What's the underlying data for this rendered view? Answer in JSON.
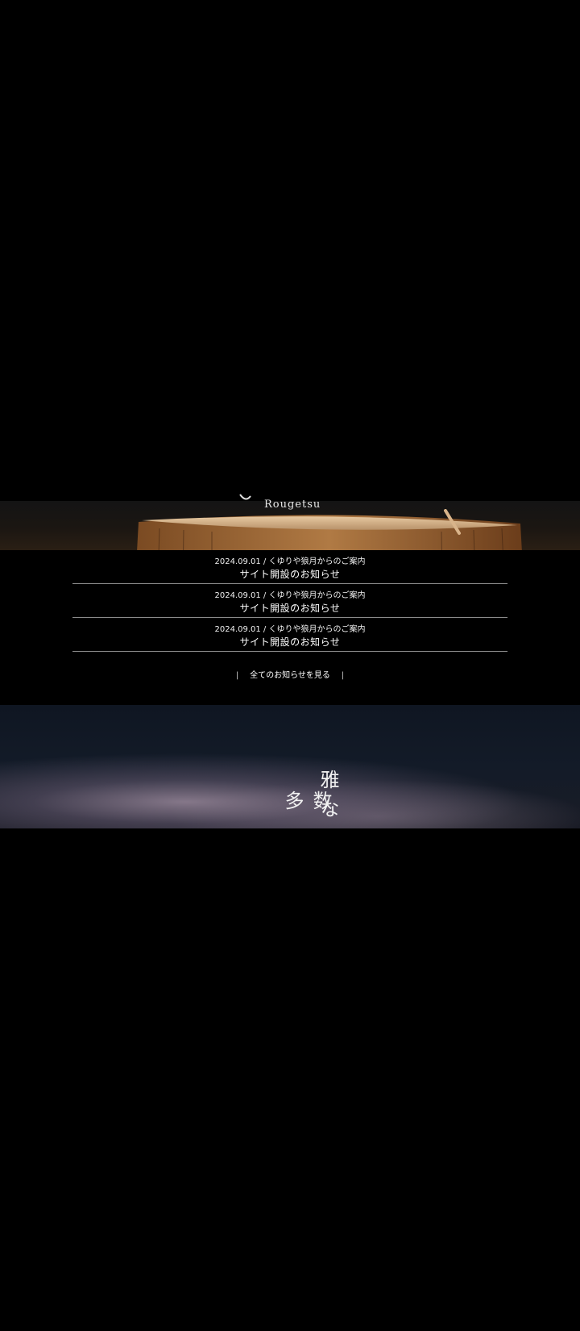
{
  "hero": {
    "logo_en": "Rougetsu"
  },
  "news": {
    "items": [
      {
        "meta": "2024.09.01 / くゆりや狼月からのご案内",
        "title": "サイト開設のお知らせ"
      },
      {
        "meta": "2024.09.01 / くゆりや狼月からのご案内",
        "title": "サイト開設のお知らせ"
      },
      {
        "meta": "2024.09.01 / くゆりや狼月からのご案内",
        "title": "サイト開設のお知らせ"
      }
    ],
    "more_label": "全てのお知らせを見る",
    "more_bar": "|"
  },
  "concept": {
    "col1": "雅な",
    "col2": "数多"
  }
}
